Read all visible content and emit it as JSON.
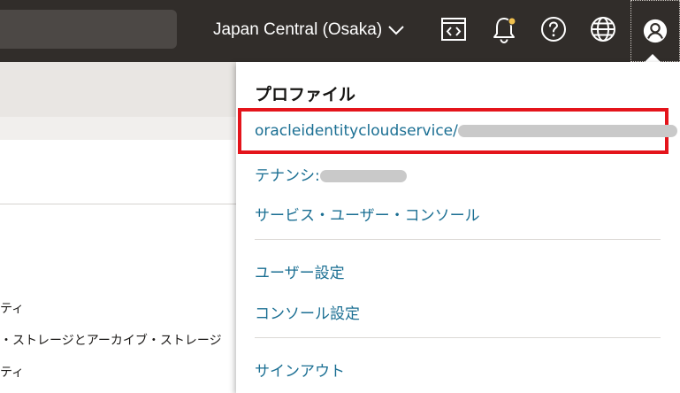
{
  "header": {
    "region": "Japan Central (Osaka)",
    "icons": [
      "code-editor-icon",
      "bell-icon",
      "help-icon",
      "globe-icon",
      "profile-icon"
    ],
    "notification_dot_color": "#f2c14e"
  },
  "background": {
    "lines": [
      "ティ",
      "・ストレージとアーカイブ・ストレージ",
      "ティ"
    ]
  },
  "profile_menu": {
    "title": "プロファイル",
    "user": "oracleidentitycloudservice/",
    "tenancy_label": "テナンシ:",
    "service_console": "サービス・ユーザー・コンソール",
    "user_settings": "ユーザー設定",
    "console_settings": "コンソール設定",
    "sign_out": "サインアウト",
    "highlight_color": "#e4141b",
    "link_color": "#1b6f93"
  }
}
